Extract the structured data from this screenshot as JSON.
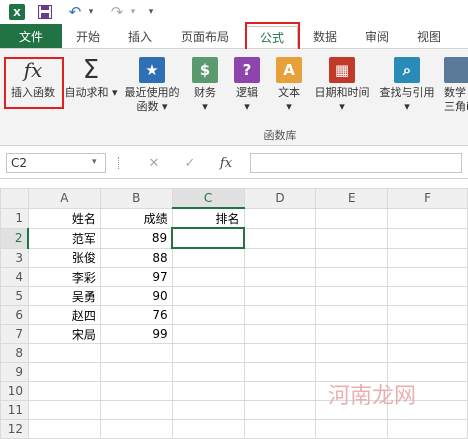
{
  "quick_access": {
    "excel_icon": "excel-logo-icon",
    "save_icon": "save-icon",
    "undo_icon": "undo-icon",
    "redo_icon": "redo-icon",
    "undo_glyph": "↶",
    "redo_glyph": "↷",
    "customize_glyph": "▾"
  },
  "tabs": [
    {
      "label": "文件"
    },
    {
      "label": "开始"
    },
    {
      "label": "插入"
    },
    {
      "label": "页面布局"
    },
    {
      "label": "公式",
      "active": true
    },
    {
      "label": "数据"
    },
    {
      "label": "审阅"
    },
    {
      "label": "视图"
    }
  ],
  "ribbon": {
    "insert_function": {
      "glyph": "fx",
      "label": "插入函数"
    },
    "autosum": {
      "glyph": "Σ",
      "label": "自动求和"
    },
    "recent": {
      "glyph": "★",
      "label_1": "最近使用的",
      "label_2": "函数"
    },
    "financial": {
      "glyph": "$",
      "label": "财务"
    },
    "logical": {
      "glyph": "?",
      "label": "逻辑"
    },
    "text": {
      "glyph": "A",
      "label": "文本"
    },
    "datetime": {
      "glyph": "▦",
      "label": "日期和时间"
    },
    "lookup": {
      "glyph": "⌕",
      "label": "查找与引用"
    },
    "math": {
      "label_1": "数学",
      "label_2": "三角i"
    },
    "dropdown_glyph": "▾",
    "group_label": "函数库",
    "colors": {
      "green": "#217346",
      "blue": "#2f6fb5",
      "purple": "#8e44ad",
      "orange": "#e8a03a",
      "red": "#c0392b",
      "teal": "#2a8bb8"
    }
  },
  "formula_bar": {
    "name_box": "C2",
    "cancel_glyph": "✕",
    "enter_glyph": "✓",
    "fx_glyph": "fx",
    "formula": ""
  },
  "sheet": {
    "columns": [
      "A",
      "B",
      "C",
      "D",
      "E",
      "F"
    ],
    "rows": [
      {
        "num": "1",
        "A": "姓名",
        "B": "成绩",
        "C": "排名"
      },
      {
        "num": "2",
        "A": "范军",
        "B": "89",
        "C": ""
      },
      {
        "num": "3",
        "A": "张俊",
        "B": "88",
        "C": ""
      },
      {
        "num": "4",
        "A": "李彩",
        "B": "97",
        "C": ""
      },
      {
        "num": "5",
        "A": "吴勇",
        "B": "90",
        "C": ""
      },
      {
        "num": "6",
        "A": "赵四",
        "B": "76",
        "C": ""
      },
      {
        "num": "7",
        "A": "宋局",
        "B": "99",
        "C": ""
      },
      {
        "num": "8",
        "A": "",
        "B": "",
        "C": ""
      },
      {
        "num": "9",
        "A": "",
        "B": "",
        "C": ""
      },
      {
        "num": "10",
        "A": "",
        "B": "",
        "C": ""
      },
      {
        "num": "11",
        "A": "",
        "B": "",
        "C": ""
      },
      {
        "num": "12",
        "A": "",
        "B": "",
        "C": ""
      }
    ]
  },
  "watermark": "河南龙网"
}
